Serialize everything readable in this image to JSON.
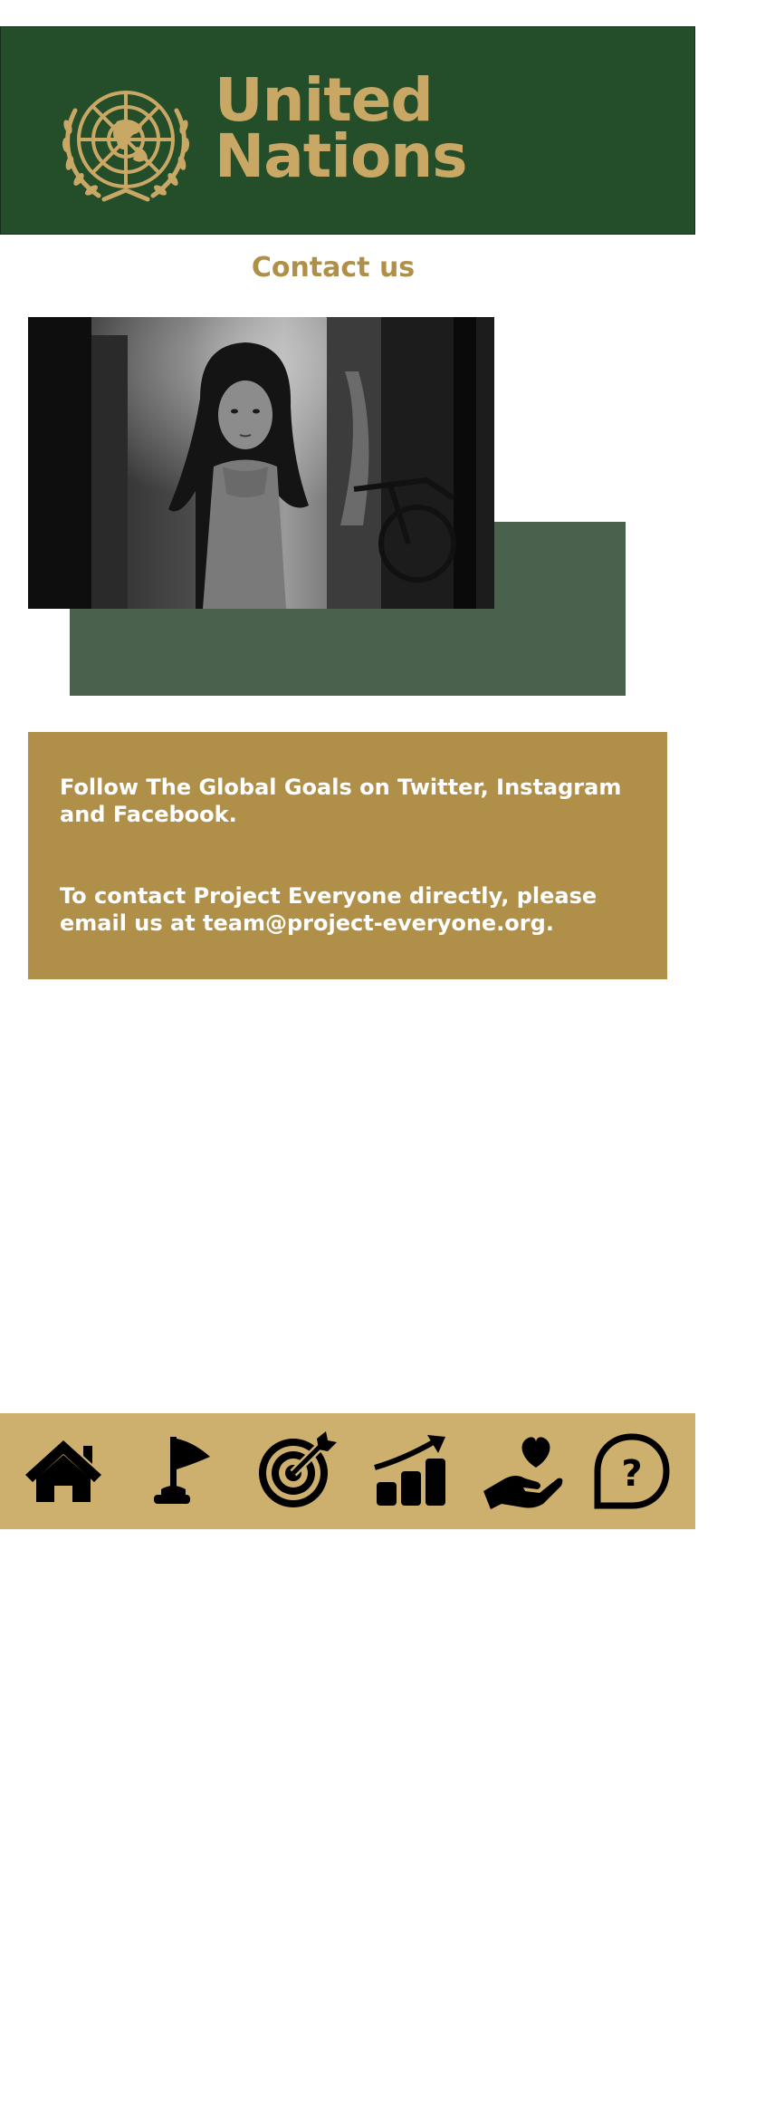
{
  "header": {
    "brand_line1": "United",
    "brand_line2": "Nations",
    "logo_icon": "un-emblem-icon"
  },
  "page": {
    "title": "Contact us"
  },
  "hero": {
    "image": "girl-photo"
  },
  "info": {
    "paragraph1": "Follow The Global Goals on Twitter, Instagram and Facebook.",
    "paragraph2": "To contact Project Everyone directly, please email us at team@project-everyone.org."
  },
  "nav": {
    "items": [
      {
        "icon": "home-icon"
      },
      {
        "icon": "flag-icon"
      },
      {
        "icon": "target-icon"
      },
      {
        "icon": "growth-chart-icon"
      },
      {
        "icon": "hand-heart-icon"
      },
      {
        "icon": "help-bubble-icon"
      }
    ]
  },
  "colors": {
    "header_bg": "#244d2a",
    "gold": "#c9a865",
    "title_gold": "#b09048",
    "green_block": "#4a614d",
    "info_bg": "#b09048",
    "nav_bg": "#cdb06e"
  }
}
